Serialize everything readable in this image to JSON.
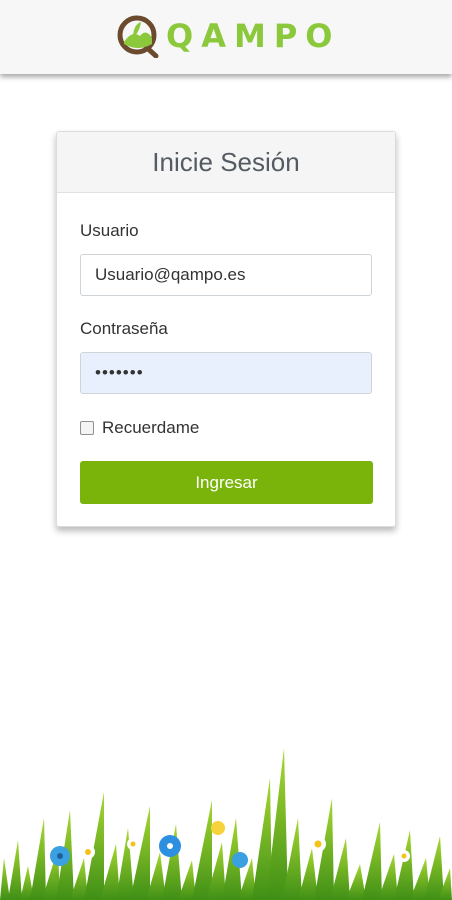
{
  "header": {
    "brand": "QAMPO",
    "logo_icon": "qampo-logo-icon"
  },
  "login": {
    "title": "Inicie Sesión",
    "user_label": "Usuario",
    "user_value": "Usuario@qampo.es",
    "password_label": "Contraseña",
    "password_value": "•••••••",
    "remember_label": "Recuerdame",
    "remember_checked": false,
    "submit_label": "Ingresar"
  },
  "colors": {
    "brand_green": "#8bc83b",
    "button_green": "#7ab30a",
    "autofill_blue": "#e8f0fe"
  }
}
